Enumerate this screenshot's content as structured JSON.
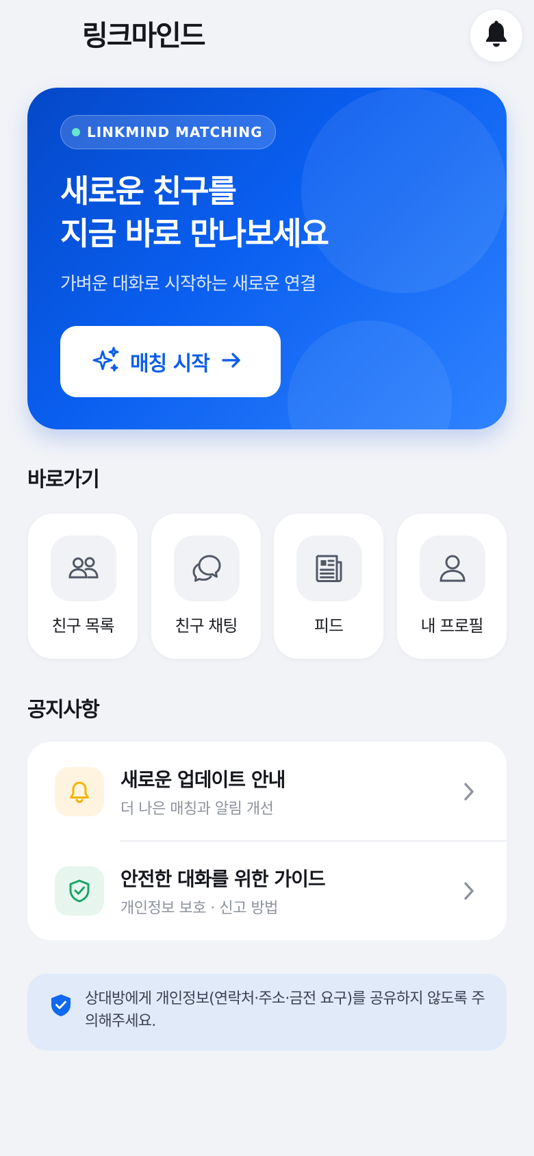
{
  "header": {
    "app_title": "링크마인드",
    "notification_icon": "bell-icon"
  },
  "hero": {
    "badge": "LINKMIND MATCHING",
    "title_line1": "새로운 친구를",
    "title_line2": "지금 바로 만나보세요",
    "subtitle": "가벼운 대화로 시작하는 새로운 연결",
    "cta_label": "매칭 시작",
    "cta_icon": "sparkles-icon",
    "cta_arrow_icon": "arrow-right-icon",
    "colors": {
      "gradient_start": "#0448c8",
      "gradient_end": "#2f83ff",
      "badge_dot": "#66e6cf",
      "cta_text": "#0c5ee8"
    }
  },
  "shortcuts": {
    "title": "바로가기",
    "items": [
      {
        "label": "친구 목록",
        "icon": "users-icon"
      },
      {
        "label": "친구 채팅",
        "icon": "chat-icon"
      },
      {
        "label": "피드",
        "icon": "newspaper-icon"
      },
      {
        "label": "내 프로필",
        "icon": "user-icon"
      }
    ]
  },
  "notices": {
    "title": "공지사항",
    "items": [
      {
        "title": "새로운 업데이트 안내",
        "subtitle": "더 나은 매칭과 알림 개선",
        "icon": "bell-icon",
        "icon_color": "#f5b400",
        "icon_bg": "#fff4e0"
      },
      {
        "title": "안전한 대화를 위한 가이드",
        "subtitle": "개인정보 보호 · 신고 방법",
        "icon": "shield-check-icon",
        "icon_color": "#1aa467",
        "icon_bg": "#e6f6ee"
      }
    ]
  },
  "safety_tip": {
    "icon": "shield-check-icon",
    "text": "상대방에게 개인정보(연락처·주소·금전 요구)를 공유하지 않도록 주의해주세요.",
    "icon_color": "#1168f0",
    "bg_color": "#e1eaf8"
  }
}
